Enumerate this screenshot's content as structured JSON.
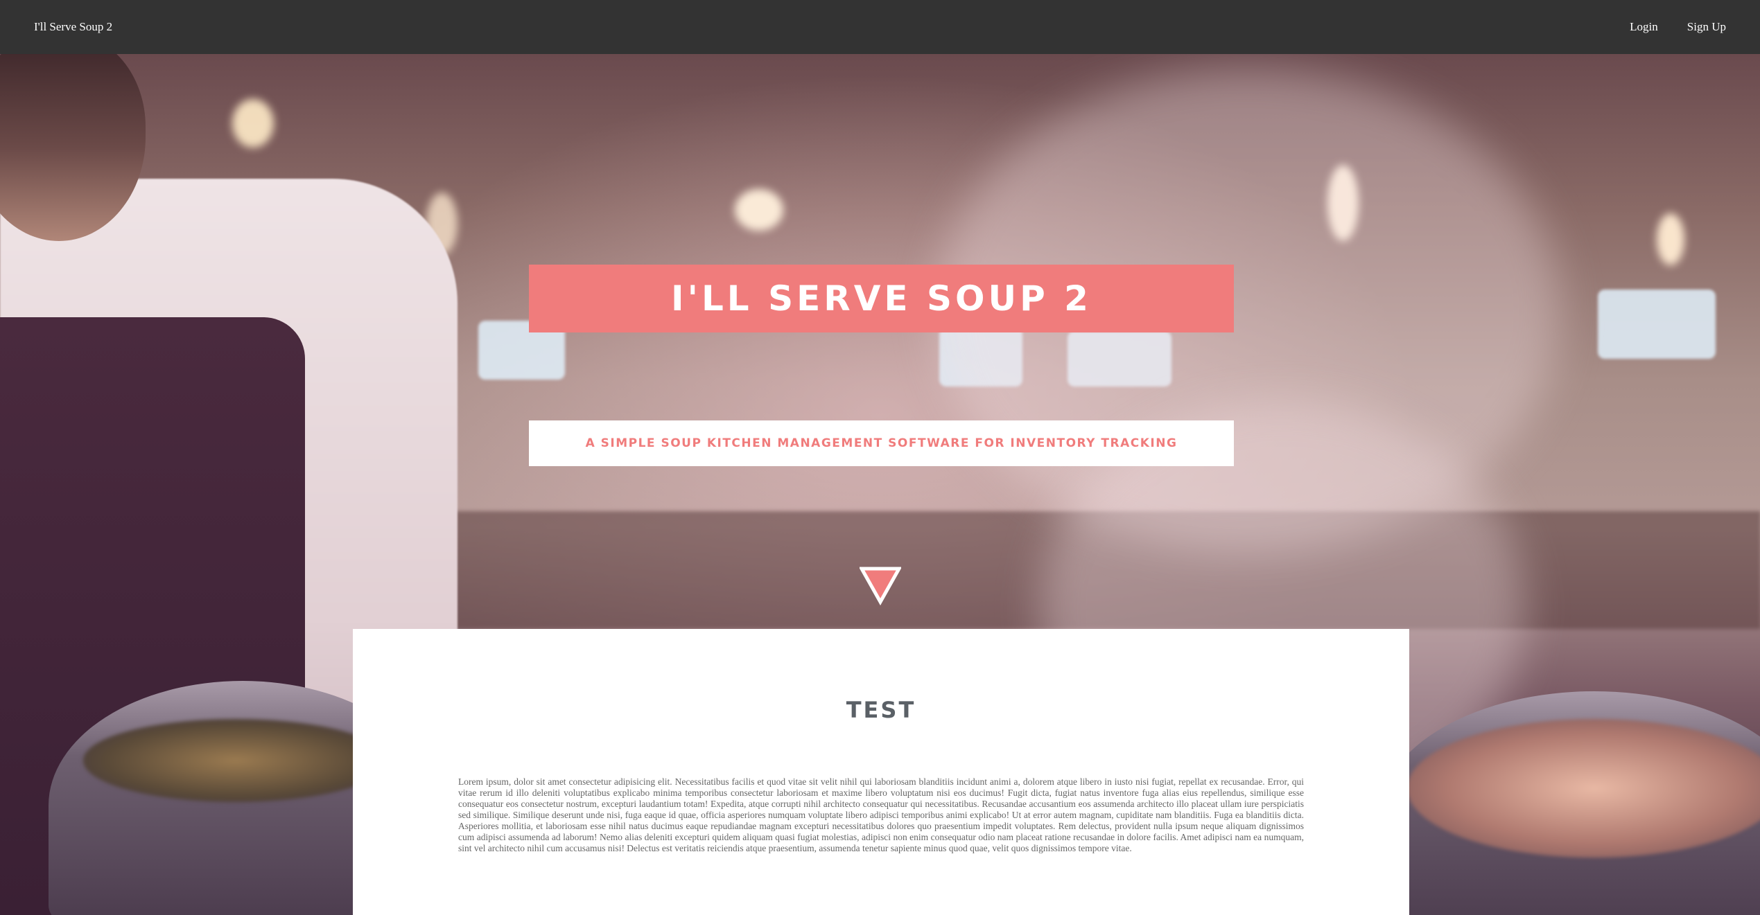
{
  "navbar": {
    "brand": "I'll Serve Soup 2",
    "links": [
      {
        "label": "Login"
      },
      {
        "label": "Sign Up"
      }
    ]
  },
  "hero": {
    "title": "I'LL SERVE SOUP 2",
    "subtitle": "A SIMPLE SOUP KITCHEN MANAGEMENT SOFTWARE FOR INVENTORY TRACKING",
    "scroll_icon": "triangle-down-icon"
  },
  "section": {
    "title": "TEST",
    "body": "Lorem ipsum, dolor sit amet consectetur adipisicing elit. Necessitatibus facilis et quod vitae sit velit nihil qui laboriosam blanditiis incidunt animi a, dolorem atque libero in iusto nisi fugiat, repellat ex recusandae. Error, qui vitae rerum id illo deleniti voluptatibus explicabo minima temporibus consectetur laboriosam et maxime libero voluptatum nisi eos ducimus! Fugit dicta, fugiat natus inventore fuga alias eius repellendus, similique esse consequatur eos consectetur nostrum, excepturi laudantium totam! Expedita, atque corrupti nihil architecto consequatur qui necessitatibus. Recusandae accusantium eos assumenda architecto illo placeat ullam iure perspiciatis sed similique. Similique deserunt unde nisi, fuga eaque id quae, officia asperiores numquam voluptate libero adipisci temporibus animi explicabo! Ut at error autem magnam, cupiditate nam blanditiis. Fuga ea blanditiis dicta. Asperiores mollitia, et laboriosam esse nihil natus ducimus eaque repudiandae magnam excepturi necessitatibus dolores quo praesentium impedit voluptates. Rem delectus, provident nulla ipsum neque aliquam dignissimos cum adipisci assumenda ad laborum! Nemo alias deleniti excepturi quidem aliquam quasi fugiat molestias, adipisci non enim consequatur odio nam placeat ratione recusandae in dolore facilis. Amet adipisci nam ea numquam, sint vel architecto nihil cum accusamus nisi! Delectus est veritatis reiciendis atque praesentium, assumenda tenetur sapiente minus quod quae, velit quos dignissimos tempore vitae."
  },
  "colors": {
    "navbar": "#333333",
    "accent": "#f07c7c",
    "card": "#ffffff",
    "heading": "#5a6066",
    "body_text": "#666666"
  }
}
